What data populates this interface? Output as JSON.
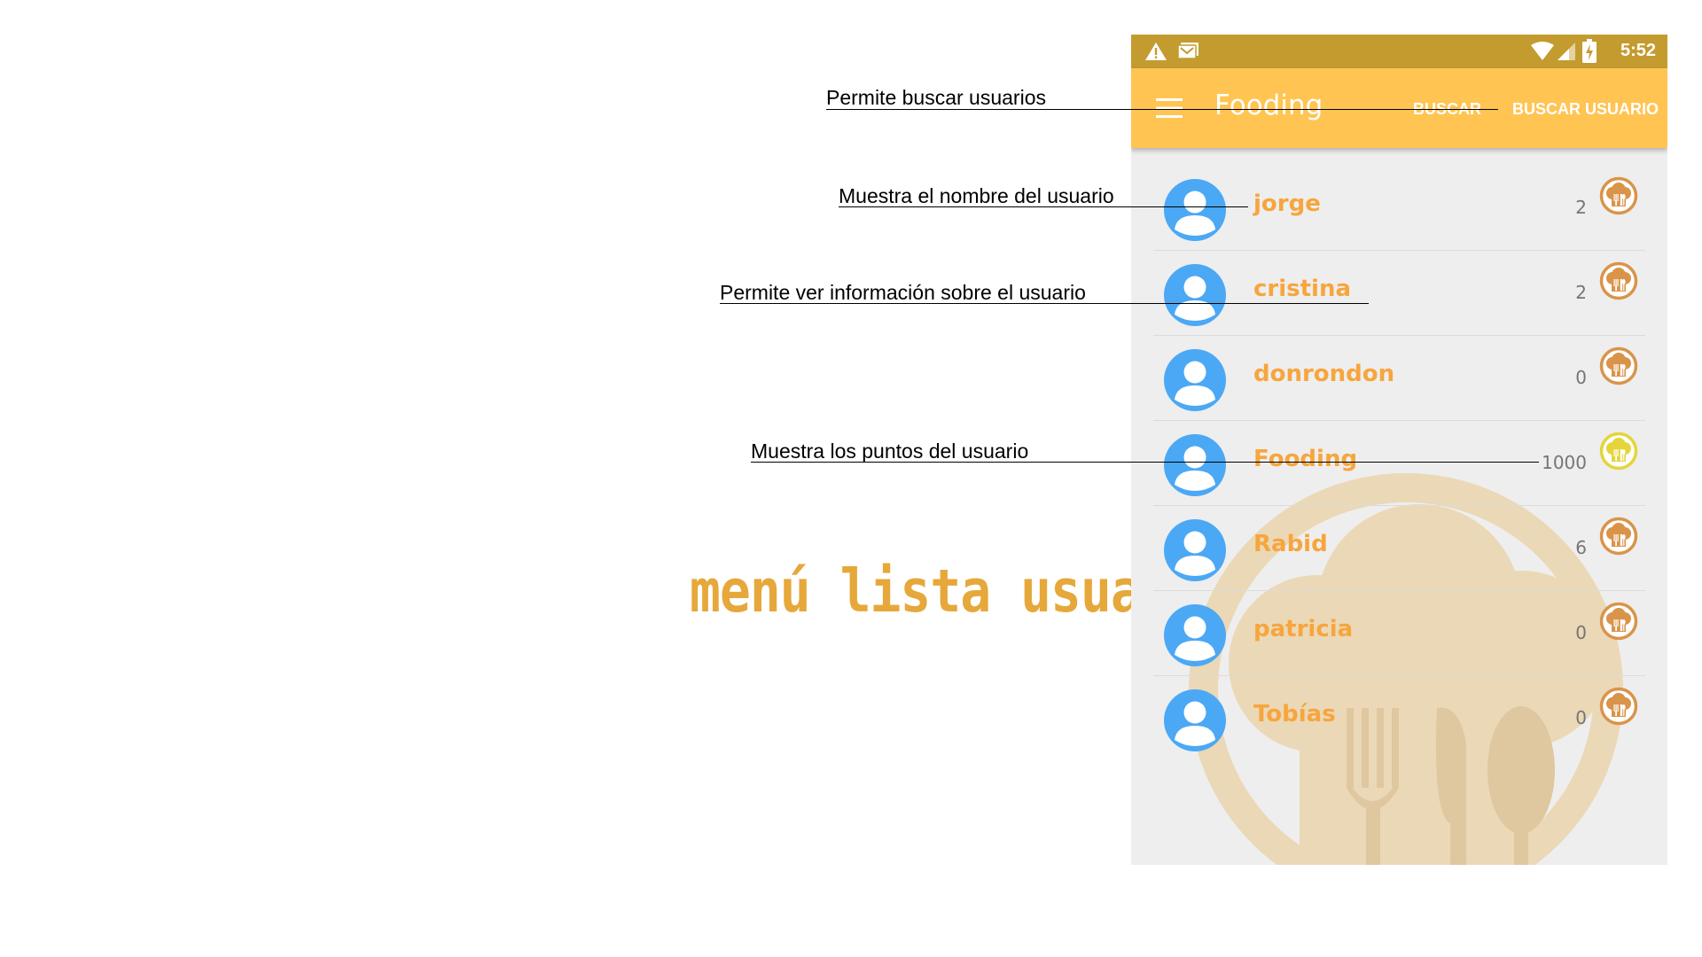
{
  "status_bar": {
    "time": "5:52",
    "left_icons": [
      "warning-icon",
      "gmail-icon"
    ],
    "right_icons": [
      "wifi-icon",
      "signal-icon",
      "battery-icon"
    ]
  },
  "toolbar": {
    "title": "Fooding",
    "actions": [
      "BUSCAR",
      "BUSCAR USUARIO"
    ]
  },
  "users": [
    {
      "name": "jorge",
      "points": "2"
    },
    {
      "name": "cristina",
      "points": "2"
    },
    {
      "name": "donrondon",
      "points": "0"
    },
    {
      "name": "Fooding",
      "points": "1000"
    },
    {
      "name": "Rabid",
      "points": "6"
    },
    {
      "name": "patricia",
      "points": "0"
    },
    {
      "name": "Tobías",
      "points": "0"
    }
  ],
  "annotations": {
    "search": "Permite buscar usuarios",
    "name": "Muestra el nombre del usuario",
    "info": "Permite ver información sobre el usuario",
    "points": "Muestra los puntos del usuario"
  },
  "caption": "menú lista usuarios",
  "colors": {
    "status_bar": "#c49b2e",
    "toolbar": "#ffc452",
    "user_name": "#f7a53d",
    "avatar": "#4ba8f5",
    "badge_default": "#d9944a",
    "badge_top": "#e4d53a",
    "caption": "#e6a83a"
  }
}
